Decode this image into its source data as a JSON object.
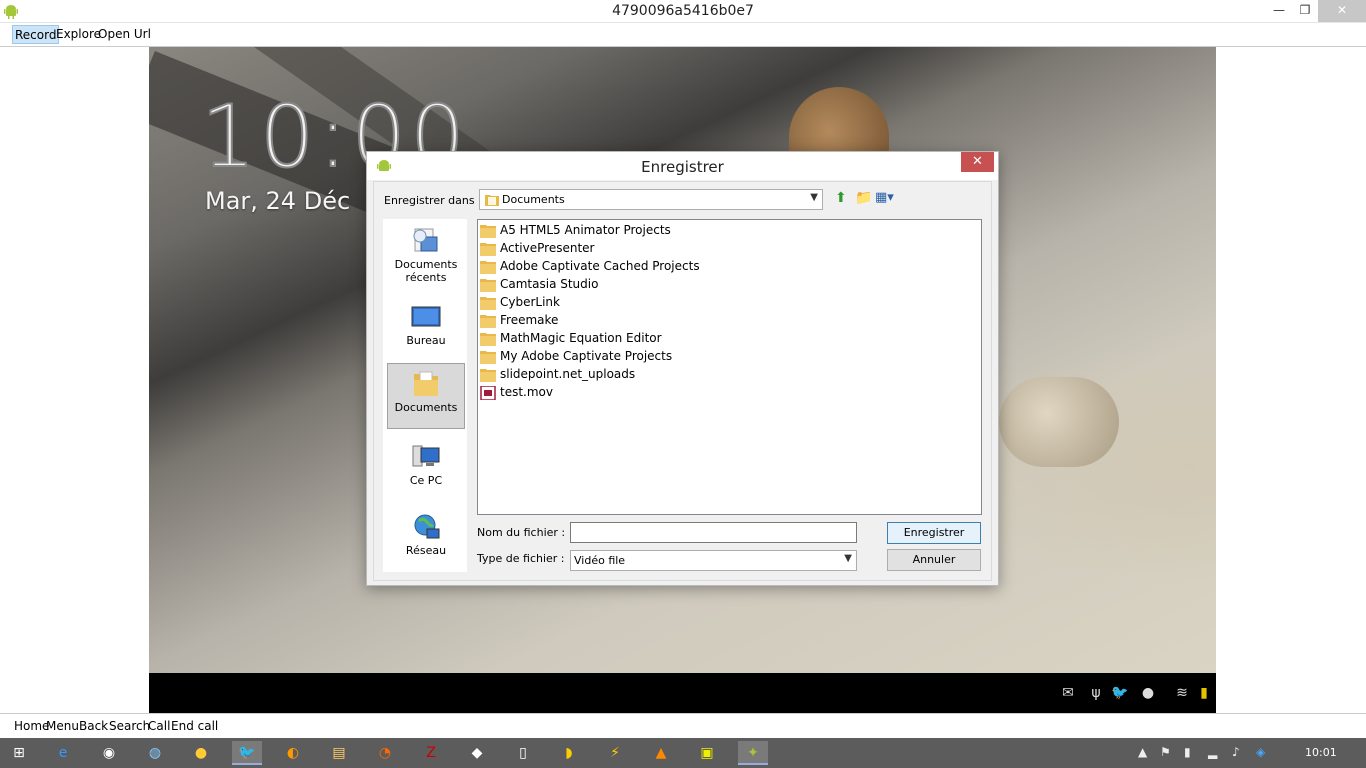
{
  "window": {
    "title": "4790096a5416b0e7",
    "minimize": "—",
    "maximize": "❐",
    "close": "✕"
  },
  "menubar": {
    "items": [
      "Record",
      "Explore",
      "Open Url"
    ]
  },
  "android": {
    "clock": "10:00",
    "date": "Mar, 24 Déc"
  },
  "bottombar": {
    "items": [
      "Home",
      "Menu",
      "Back",
      "Search",
      "Call",
      "End call"
    ]
  },
  "dialog": {
    "title": "Enregistrer",
    "close": "✕",
    "save_in_label": "Enregistrer dans :",
    "save_in_value": "Documents",
    "places": [
      {
        "label": "Documents récents",
        "icon": "recent-documents-icon"
      },
      {
        "label": "Bureau",
        "icon": "desktop-icon"
      },
      {
        "label": "Documents",
        "icon": "documents-folder-icon"
      },
      {
        "label": "Ce PC",
        "icon": "computer-icon"
      },
      {
        "label": "Réseau",
        "icon": "network-icon"
      }
    ],
    "files": [
      {
        "name": "A5 HTML5 Animator Projects",
        "type": "folder"
      },
      {
        "name": "ActivePresenter",
        "type": "folder"
      },
      {
        "name": "Adobe Captivate Cached Projects",
        "type": "folder"
      },
      {
        "name": "Camtasia Studio",
        "type": "folder"
      },
      {
        "name": "CyberLink",
        "type": "folder"
      },
      {
        "name": "Freemake",
        "type": "folder"
      },
      {
        "name": "MathMagic Equation Editor",
        "type": "folder"
      },
      {
        "name": "My Adobe Captivate Projects",
        "type": "folder"
      },
      {
        "name": "slidepoint.net_uploads",
        "type": "folder"
      },
      {
        "name": "test.mov",
        "type": "video"
      }
    ],
    "filename_label": "Nom du fichier :",
    "filename_value": "",
    "filetype_label": "Type de fichier :",
    "filetype_value": "Vidéo file",
    "save_button": "Enregistrer",
    "cancel_button": "Annuler"
  },
  "taskbar": {
    "time": "10:01"
  },
  "colors": {
    "accent": "#3c7fb1",
    "android_green": "#a4c639",
    "folder": "#e8b84a",
    "taskbar": "#5c5c5c"
  }
}
